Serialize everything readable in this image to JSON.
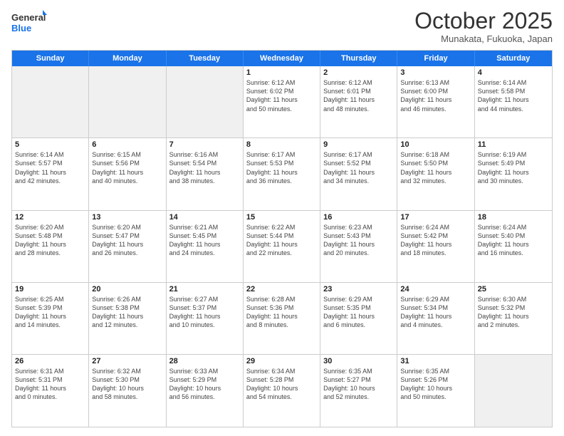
{
  "logo": {
    "line1": "General",
    "line2": "Blue"
  },
  "title": "October 2025",
  "subtitle": "Munakata, Fukuoka, Japan",
  "days": [
    "Sunday",
    "Monday",
    "Tuesday",
    "Wednesday",
    "Thursday",
    "Friday",
    "Saturday"
  ],
  "weeks": [
    [
      {
        "day": "",
        "info": ""
      },
      {
        "day": "",
        "info": ""
      },
      {
        "day": "",
        "info": ""
      },
      {
        "day": "1",
        "info": "Sunrise: 6:12 AM\nSunset: 6:02 PM\nDaylight: 11 hours\nand 50 minutes."
      },
      {
        "day": "2",
        "info": "Sunrise: 6:12 AM\nSunset: 6:01 PM\nDaylight: 11 hours\nand 48 minutes."
      },
      {
        "day": "3",
        "info": "Sunrise: 6:13 AM\nSunset: 6:00 PM\nDaylight: 11 hours\nand 46 minutes."
      },
      {
        "day": "4",
        "info": "Sunrise: 6:14 AM\nSunset: 5:58 PM\nDaylight: 11 hours\nand 44 minutes."
      }
    ],
    [
      {
        "day": "5",
        "info": "Sunrise: 6:14 AM\nSunset: 5:57 PM\nDaylight: 11 hours\nand 42 minutes."
      },
      {
        "day": "6",
        "info": "Sunrise: 6:15 AM\nSunset: 5:56 PM\nDaylight: 11 hours\nand 40 minutes."
      },
      {
        "day": "7",
        "info": "Sunrise: 6:16 AM\nSunset: 5:54 PM\nDaylight: 11 hours\nand 38 minutes."
      },
      {
        "day": "8",
        "info": "Sunrise: 6:17 AM\nSunset: 5:53 PM\nDaylight: 11 hours\nand 36 minutes."
      },
      {
        "day": "9",
        "info": "Sunrise: 6:17 AM\nSunset: 5:52 PM\nDaylight: 11 hours\nand 34 minutes."
      },
      {
        "day": "10",
        "info": "Sunrise: 6:18 AM\nSunset: 5:50 PM\nDaylight: 11 hours\nand 32 minutes."
      },
      {
        "day": "11",
        "info": "Sunrise: 6:19 AM\nSunset: 5:49 PM\nDaylight: 11 hours\nand 30 minutes."
      }
    ],
    [
      {
        "day": "12",
        "info": "Sunrise: 6:20 AM\nSunset: 5:48 PM\nDaylight: 11 hours\nand 28 minutes."
      },
      {
        "day": "13",
        "info": "Sunrise: 6:20 AM\nSunset: 5:47 PM\nDaylight: 11 hours\nand 26 minutes."
      },
      {
        "day": "14",
        "info": "Sunrise: 6:21 AM\nSunset: 5:45 PM\nDaylight: 11 hours\nand 24 minutes."
      },
      {
        "day": "15",
        "info": "Sunrise: 6:22 AM\nSunset: 5:44 PM\nDaylight: 11 hours\nand 22 minutes."
      },
      {
        "day": "16",
        "info": "Sunrise: 6:23 AM\nSunset: 5:43 PM\nDaylight: 11 hours\nand 20 minutes."
      },
      {
        "day": "17",
        "info": "Sunrise: 6:24 AM\nSunset: 5:42 PM\nDaylight: 11 hours\nand 18 minutes."
      },
      {
        "day": "18",
        "info": "Sunrise: 6:24 AM\nSunset: 5:40 PM\nDaylight: 11 hours\nand 16 minutes."
      }
    ],
    [
      {
        "day": "19",
        "info": "Sunrise: 6:25 AM\nSunset: 5:39 PM\nDaylight: 11 hours\nand 14 minutes."
      },
      {
        "day": "20",
        "info": "Sunrise: 6:26 AM\nSunset: 5:38 PM\nDaylight: 11 hours\nand 12 minutes."
      },
      {
        "day": "21",
        "info": "Sunrise: 6:27 AM\nSunset: 5:37 PM\nDaylight: 11 hours\nand 10 minutes."
      },
      {
        "day": "22",
        "info": "Sunrise: 6:28 AM\nSunset: 5:36 PM\nDaylight: 11 hours\nand 8 minutes."
      },
      {
        "day": "23",
        "info": "Sunrise: 6:29 AM\nSunset: 5:35 PM\nDaylight: 11 hours\nand 6 minutes."
      },
      {
        "day": "24",
        "info": "Sunrise: 6:29 AM\nSunset: 5:34 PM\nDaylight: 11 hours\nand 4 minutes."
      },
      {
        "day": "25",
        "info": "Sunrise: 6:30 AM\nSunset: 5:32 PM\nDaylight: 11 hours\nand 2 minutes."
      }
    ],
    [
      {
        "day": "26",
        "info": "Sunrise: 6:31 AM\nSunset: 5:31 PM\nDaylight: 11 hours\nand 0 minutes."
      },
      {
        "day": "27",
        "info": "Sunrise: 6:32 AM\nSunset: 5:30 PM\nDaylight: 10 hours\nand 58 minutes."
      },
      {
        "day": "28",
        "info": "Sunrise: 6:33 AM\nSunset: 5:29 PM\nDaylight: 10 hours\nand 56 minutes."
      },
      {
        "day": "29",
        "info": "Sunrise: 6:34 AM\nSunset: 5:28 PM\nDaylight: 10 hours\nand 54 minutes."
      },
      {
        "day": "30",
        "info": "Sunrise: 6:35 AM\nSunset: 5:27 PM\nDaylight: 10 hours\nand 52 minutes."
      },
      {
        "day": "31",
        "info": "Sunrise: 6:35 AM\nSunset: 5:26 PM\nDaylight: 10 hours\nand 50 minutes."
      },
      {
        "day": "",
        "info": ""
      }
    ]
  ]
}
